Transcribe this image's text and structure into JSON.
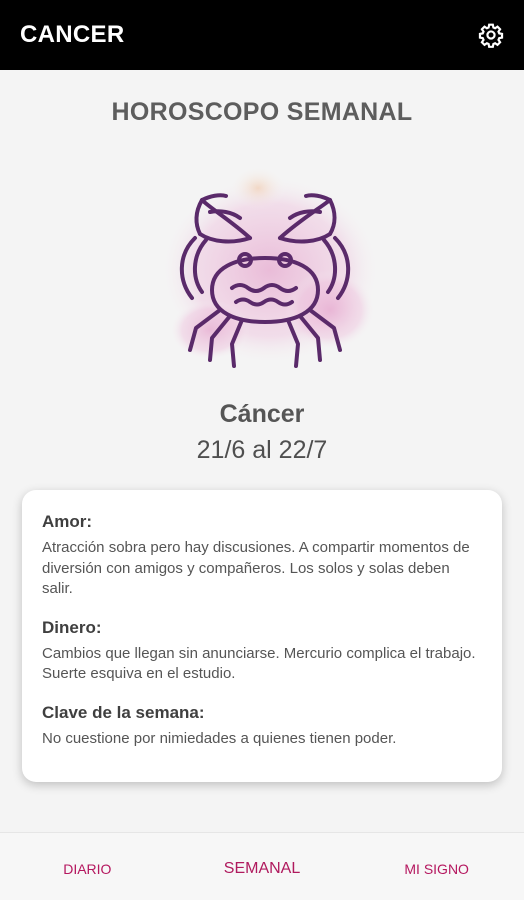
{
  "app_bar": {
    "title": "CANCER",
    "settings_icon": "gear-icon"
  },
  "main": {
    "page_title": "HOROSCOPO SEMANAL",
    "sign_icon": "cancer-crab-icon",
    "sign_name": "Cáncer",
    "sign_dates": "21/6 al 22/7"
  },
  "card": {
    "sections": [
      {
        "heading": "Amor:",
        "text": "Atracción sobra pero hay discusiones. A compartir momentos de diversión con amigos y compañeros. Los solos y solas deben salir."
      },
      {
        "heading": "Dinero:",
        "text": "Cambios que llegan sin anunciarse. Mercurio complica el trabajo. Suerte esquiva en el estudio."
      },
      {
        "heading": "Clave de la semana:",
        "text": "No cuestione por nimiedades a quienes tienen poder."
      }
    ]
  },
  "bottom_nav": {
    "items": [
      {
        "label": "DIARIO"
      },
      {
        "label": "SEMANAL"
      },
      {
        "label": "MI SIGNO"
      }
    ],
    "active": "SEMANAL"
  },
  "colors": {
    "app_bar": "#000000",
    "accent": "#b5175f",
    "card": "#ffffff",
    "watercolor": "#e6a9cf",
    "crab_stroke": "#5a2a6a"
  }
}
